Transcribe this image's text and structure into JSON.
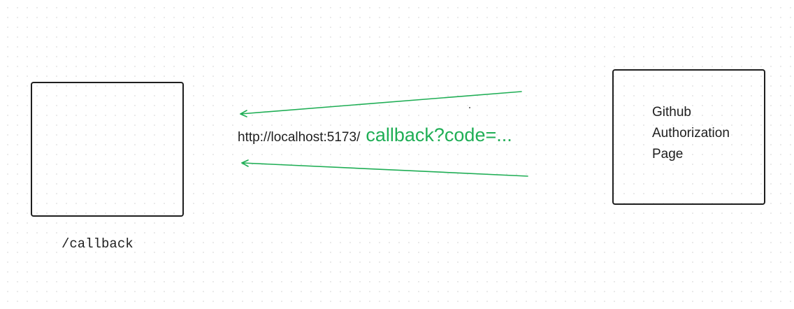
{
  "client": {
    "route_label": "/callback"
  },
  "auth_page": {
    "lines": [
      "Github",
      "Authorization",
      "Page"
    ]
  },
  "redirect": {
    "base_url": "http://localhost:5173/",
    "path": "callback?code=..."
  },
  "colors": {
    "arrow": "#1fae55",
    "box_stroke": "#1e1e1e",
    "highlight_text": "#1fae55"
  }
}
